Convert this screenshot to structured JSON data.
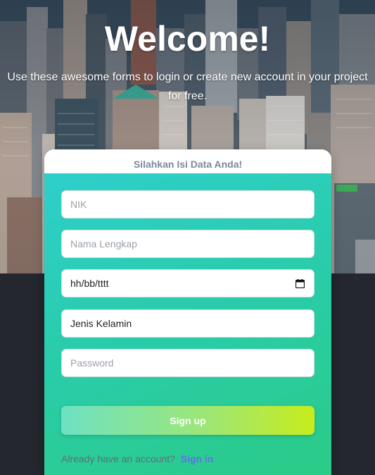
{
  "hero": {
    "title": "Welcome!",
    "subtitle": "Use these awesome forms to login or create new account in your project for free."
  },
  "form": {
    "heading": "Silahkan Isi Data Anda!",
    "nik_placeholder": "NIK",
    "name_placeholder": "Nama Lengkap",
    "date_value": "hh/bb/tttt",
    "gender_value": "Jenis Kelamin",
    "password_placeholder": "Password",
    "signup_label": "Sign up",
    "account_prompt": "Already have an account?",
    "signin_label": "Sign in"
  },
  "colors": {
    "card_gradient_start": "#2ecfcb",
    "card_gradient_end": "#2bcb86",
    "button_gradient_start": "#6ee1c2",
    "button_gradient_end": "#c8ec1c",
    "link": "#5e72e4",
    "background": "#24272d"
  },
  "icons": {
    "date": "calendar-icon"
  }
}
